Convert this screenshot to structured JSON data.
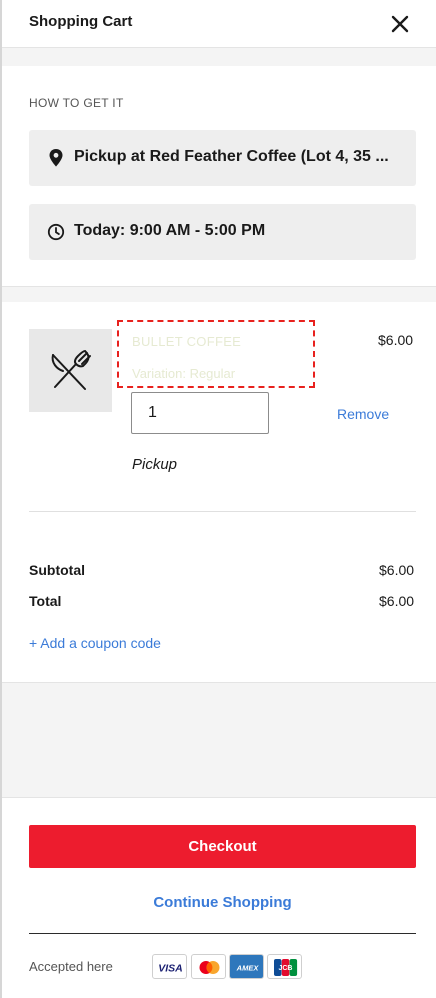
{
  "header": {
    "title": "Shopping Cart"
  },
  "fulfillment_section": {
    "label": "HOW TO GET IT",
    "pickup_text": "Pickup at Red Feather Coffee (Lot 4, 35 ...",
    "time_text": "Today: 9:00 AM - 5:00 PM"
  },
  "cart": {
    "items": [
      {
        "name": "BULLET COFFEE",
        "variation": "Variation: Regular",
        "price": "$6.00",
        "quantity": "1",
        "remove_label": "Remove",
        "fulfillment": "Pickup"
      }
    ]
  },
  "summary": {
    "subtotal_label": "Subtotal",
    "subtotal_value": "$6.00",
    "total_label": "Total",
    "total_value": "$6.00",
    "coupon_label": "+ Add a coupon code"
  },
  "footer": {
    "checkout_label": "Checkout",
    "continue_label": "Continue Shopping",
    "accepted_label": "Accepted here",
    "cards": [
      "VISA",
      "mastercard",
      "AMEX",
      "JCB"
    ]
  },
  "colors": {
    "accent_red": "#ed1c2e",
    "link_blue": "#3b7bd8",
    "highlight_red": "#e8211e"
  }
}
